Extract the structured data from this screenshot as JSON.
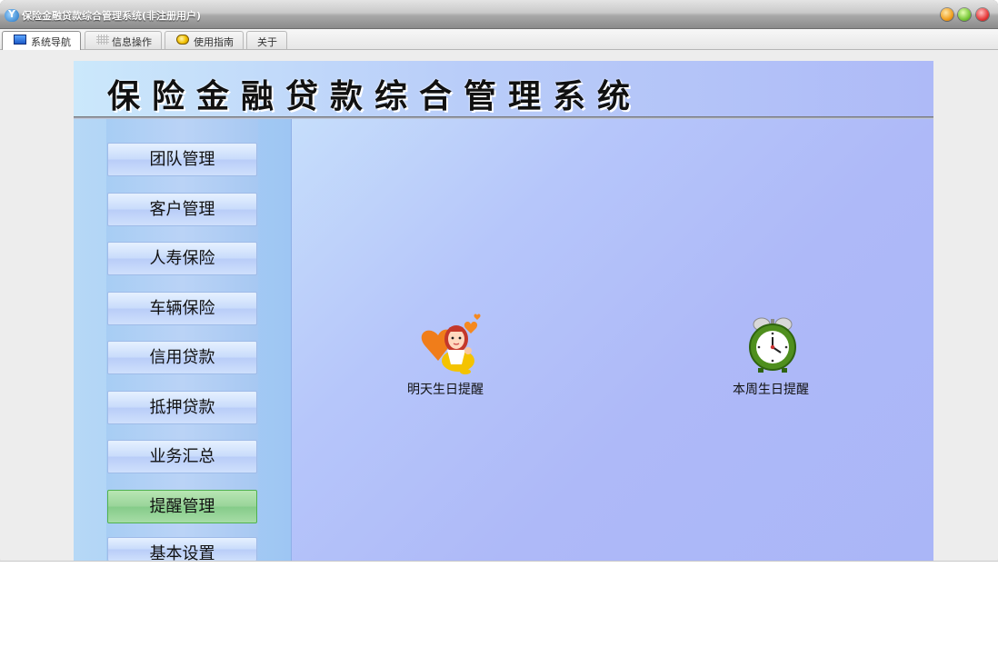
{
  "window": {
    "title": "保险金融贷款综合管理系统(非注册用户)",
    "controls": [
      "minimize",
      "maximize",
      "close"
    ]
  },
  "tabs": [
    {
      "label": "系统导航",
      "icon": "monitor-icon",
      "active": true
    },
    {
      "label": "信息操作",
      "icon": "grid-icon",
      "active": false
    },
    {
      "label": "使用指南",
      "icon": "guide-icon",
      "active": false
    },
    {
      "label": "关于",
      "icon": "",
      "active": false
    }
  ],
  "banner": {
    "title": "保险金融贷款综合管理系统"
  },
  "menu": [
    {
      "label": "团队管理",
      "active": false
    },
    {
      "label": "客户管理",
      "active": false
    },
    {
      "label": "人寿保险",
      "active": false
    },
    {
      "label": "车辆保险",
      "active": false
    },
    {
      "label": "信用贷款",
      "active": false
    },
    {
      "label": "抵押贷款",
      "active": false
    },
    {
      "label": "业务汇总",
      "active": false
    },
    {
      "label": "提醒管理",
      "active": true
    },
    {
      "label": "基本设置",
      "active": false
    }
  ],
  "tools": [
    {
      "label": "明天生日提醒",
      "icon": "birthday-girl-icon"
    },
    {
      "label": "本周生日提醒",
      "icon": "alarm-clock-icon"
    }
  ],
  "colors": {
    "active_menu": "#9ad59a",
    "menu": "#c9dcfb",
    "content_bg": "#aeb9f8"
  }
}
